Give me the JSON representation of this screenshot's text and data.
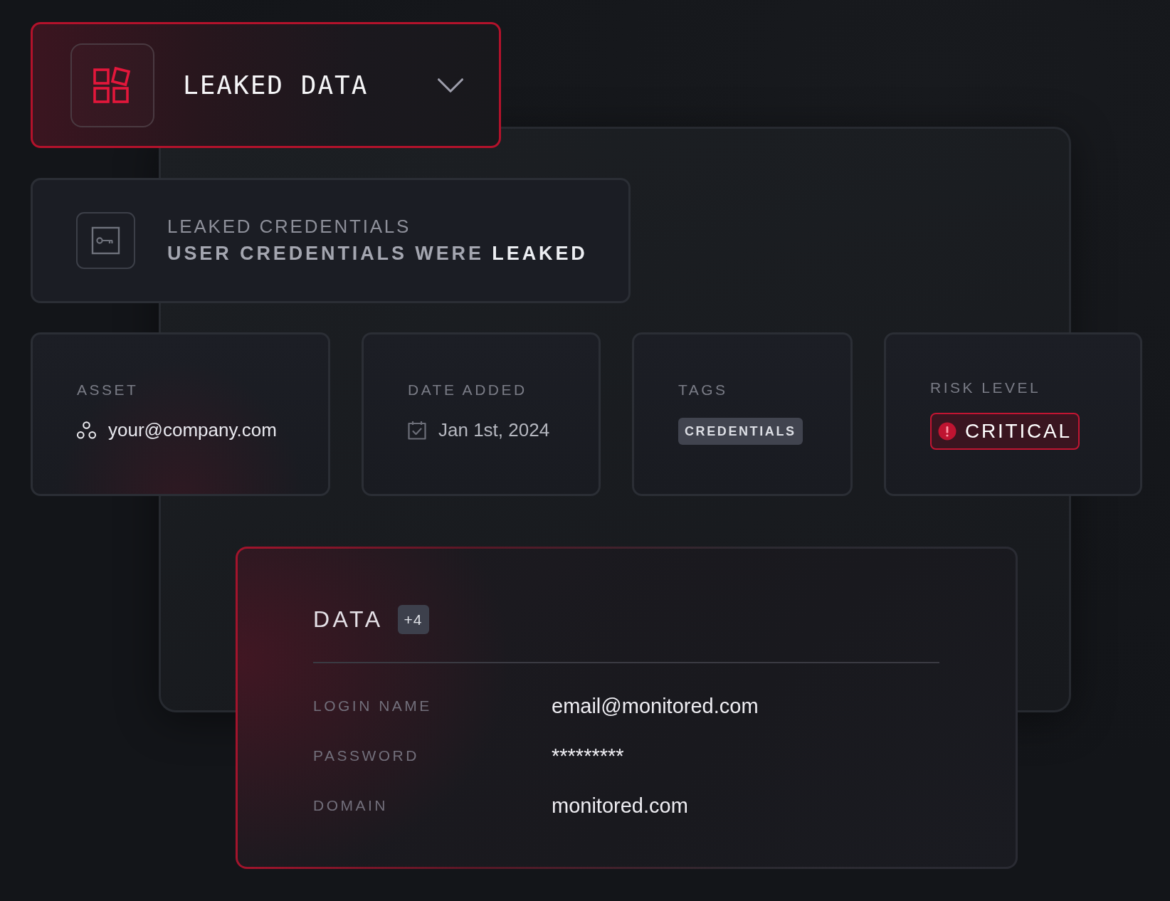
{
  "dropdown": {
    "title": "LEAKED DATA"
  },
  "alert": {
    "label": "LEAKED CREDENTIALS",
    "message": "USER CREDENTIALS WERE **LEAKED**"
  },
  "details": [
    {
      "kind": "asset",
      "label": "ASSET",
      "value": "your@company.com"
    },
    {
      "kind": "date",
      "label": "DATE ADDED",
      "value": "Jan 1st, 2024"
    },
    {
      "kind": "tags",
      "label": "TAGS",
      "tags": [
        "CREDENTIALS"
      ]
    },
    {
      "kind": "risk",
      "label": "RISK LEVEL",
      "value": "CRITICAL"
    }
  ],
  "data": {
    "title": "DATA",
    "count": "+4",
    "fields": [
      {
        "label": "LOGIN NAME",
        "value": "email@monitored.com"
      },
      {
        "label": "PASSWORD",
        "value": "*********"
      },
      {
        "label": "DOMAIN",
        "value": "monitored.com"
      }
    ]
  }
}
